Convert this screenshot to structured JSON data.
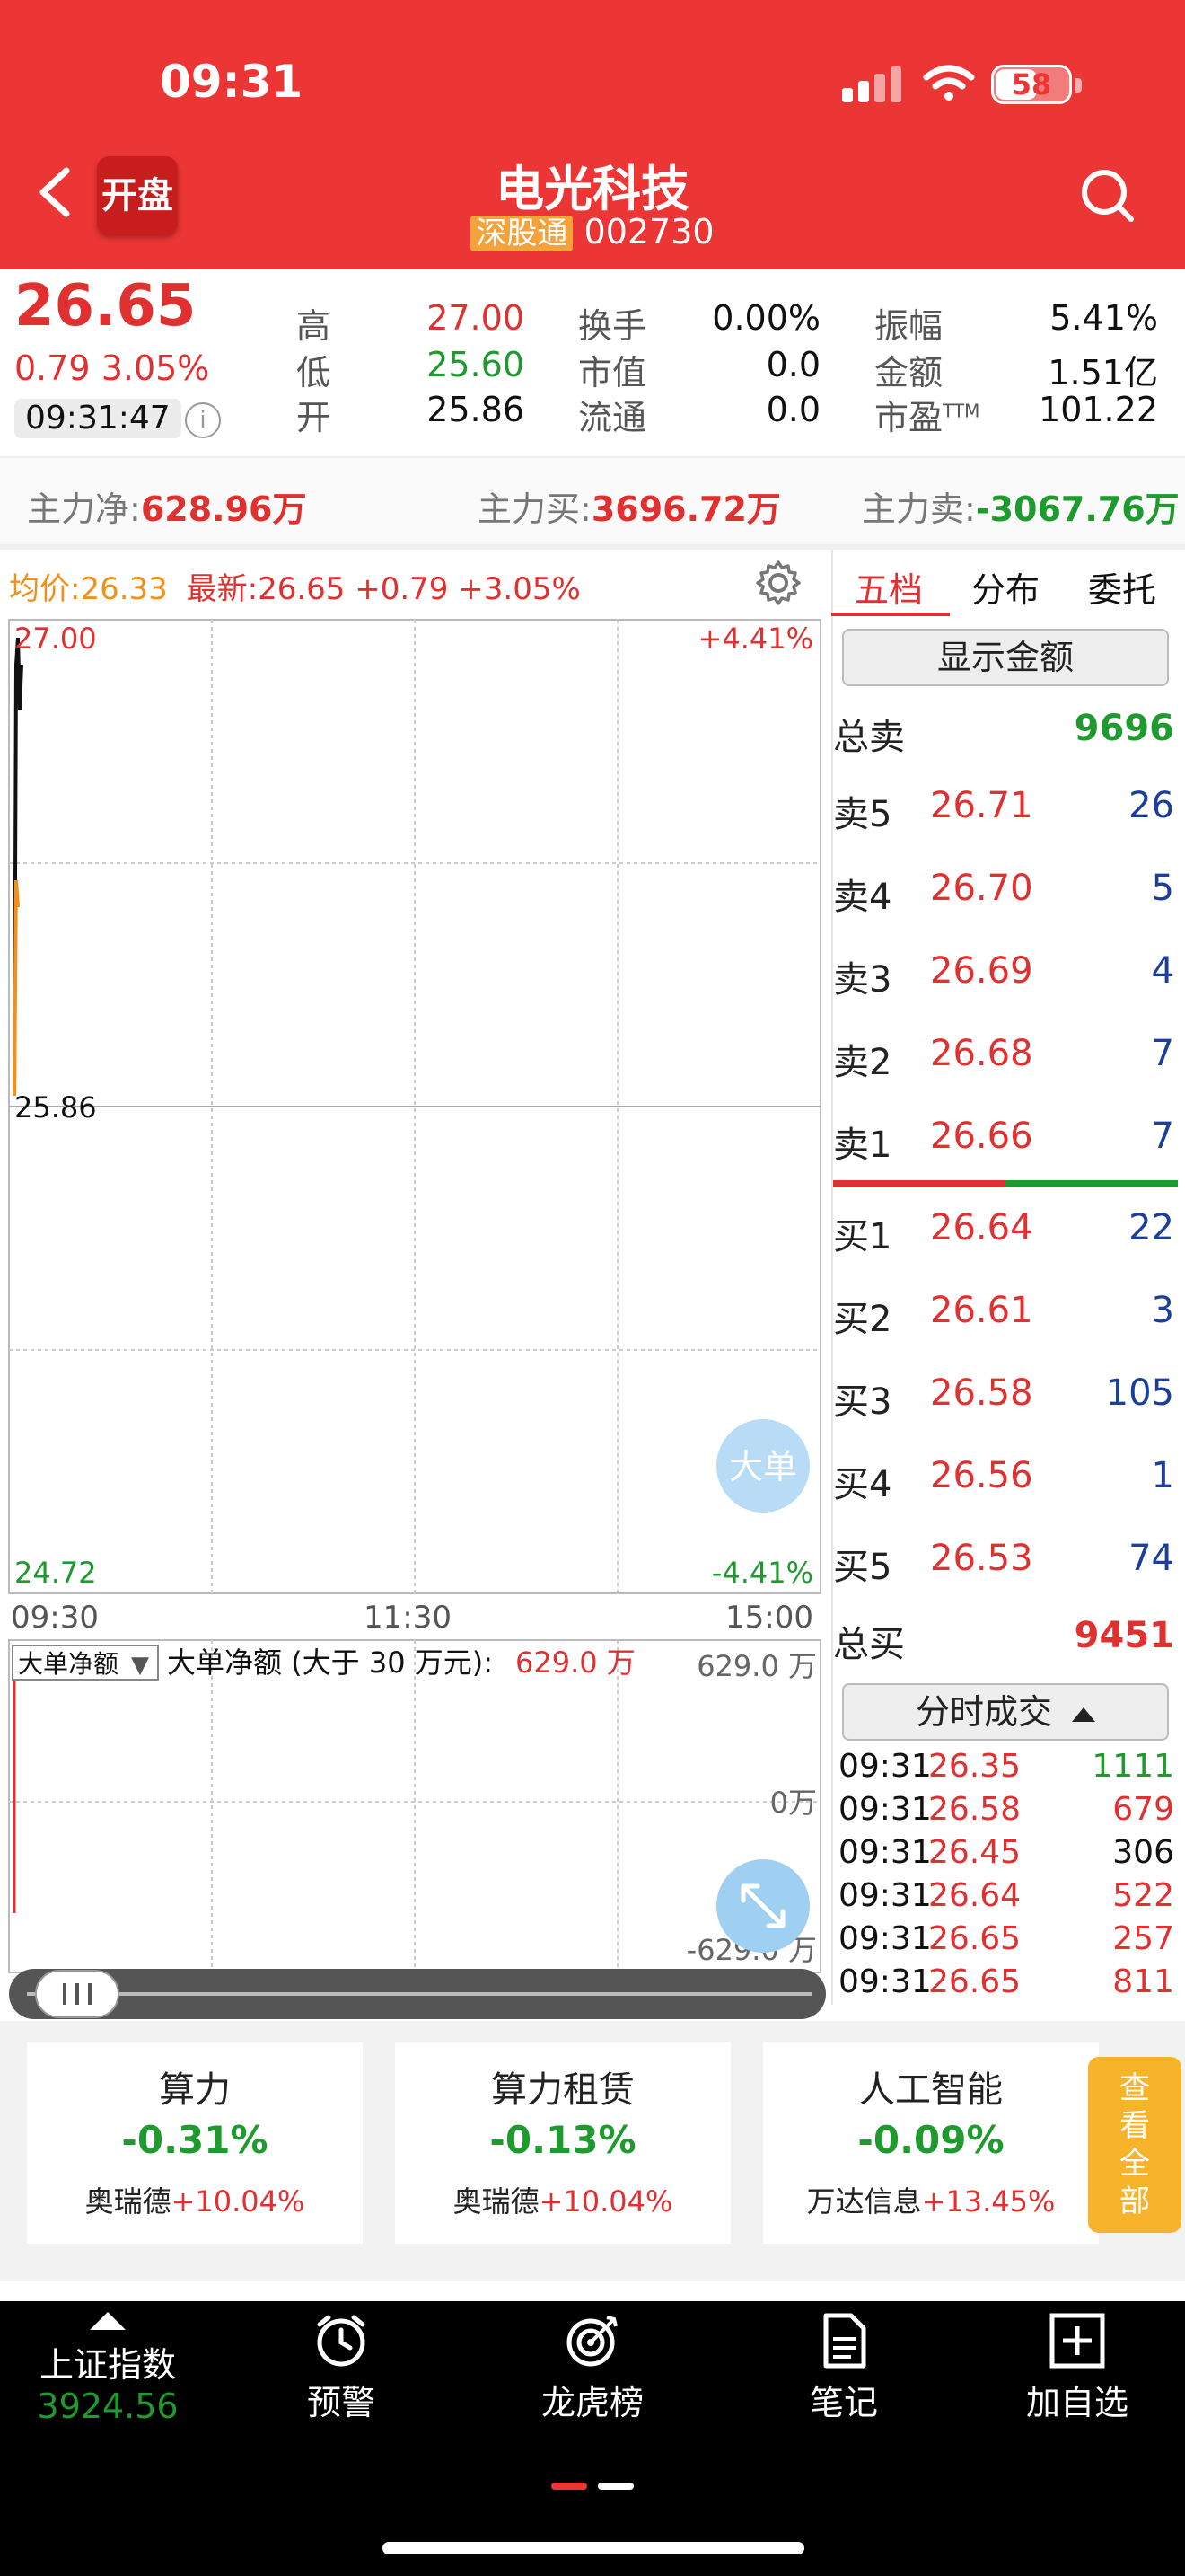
{
  "status": {
    "time": "09:31",
    "battery": "58"
  },
  "header": {
    "badge": "开盘",
    "name": "电光科技",
    "exchange_tag": "深股通",
    "code": "002730"
  },
  "quote": {
    "price": "26.65",
    "change": "0.79 3.05%",
    "time": "09:31:47",
    "fields": [
      {
        "label": "高",
        "value": "27.00",
        "color": "#e03030"
      },
      {
        "label": "低",
        "value": "25.60",
        "color": "#1f9a2e"
      },
      {
        "label": "开",
        "value": "25.86",
        "color": "#111111"
      },
      {
        "label": "换手",
        "value": "0.00%",
        "color": "#111111"
      },
      {
        "label": "市值",
        "value": "0.0",
        "color": "#111111"
      },
      {
        "label": "流通",
        "value": "0.0",
        "color": "#111111"
      },
      {
        "label": "振幅",
        "value": "5.41%",
        "color": "#111111"
      },
      {
        "label": "金额",
        "value": "1.51亿",
        "color": "#111111"
      },
      {
        "label": "市盈",
        "label_sup": "TTM",
        "value": "101.22",
        "color": "#111111"
      }
    ]
  },
  "flow": {
    "net_label": "主力净:",
    "net_value": "628.96万",
    "buy_label": "主力买:",
    "buy_value": "3696.72万",
    "sell_label": "主力卖:",
    "sell_value": "-3067.76万"
  },
  "chart_legend": {
    "avg_label": "均价:",
    "avg_value": "26.33",
    "latest_label": "最新:",
    "latest_value": "26.65",
    "latest_change": "+0.79",
    "latest_pct": "+3.05%"
  },
  "chart_data": [
    {
      "type": "line",
      "ylim": [
        24.72,
        27.0
      ],
      "y_ticks_left": [
        "27.00",
        "25.86",
        "24.72"
      ],
      "y_ticks_right": [
        "+4.41%",
        "-4.41%"
      ],
      "x_ticks": [
        "09:30",
        "11:30",
        "15:00"
      ],
      "series": [],
      "grid": true,
      "big_order_button": "大单"
    },
    {
      "type": "bar",
      "selector": "大单净额",
      "title_label": "大单净额 (大于 30 万元):",
      "title_value": "629.0 万",
      "y_ticks": [
        "629.0 万",
        "0万",
        "-629.0 万"
      ],
      "ylim": [
        -629.0,
        629.0
      ],
      "grid": true
    }
  ],
  "panel": {
    "tabs": [
      "五档",
      "分布",
      "委托"
    ],
    "show_amount": "显示金额",
    "total_sell_label": "总卖",
    "total_sell": "9696",
    "asks": [
      {
        "label": "卖5",
        "price": "26.71",
        "vol": "26"
      },
      {
        "label": "卖4",
        "price": "26.70",
        "vol": "5"
      },
      {
        "label": "卖3",
        "price": "26.69",
        "vol": "4"
      },
      {
        "label": "卖2",
        "price": "26.68",
        "vol": "7"
      },
      {
        "label": "卖1",
        "price": "26.66",
        "vol": "7"
      }
    ],
    "bids": [
      {
        "label": "买1",
        "price": "26.64",
        "vol": "22"
      },
      {
        "label": "买2",
        "price": "26.61",
        "vol": "3"
      },
      {
        "label": "买3",
        "price": "26.58",
        "vol": "105"
      },
      {
        "label": "买4",
        "price": "26.56",
        "vol": "1"
      },
      {
        "label": "买5",
        "price": "26.53",
        "vol": "74"
      }
    ],
    "total_buy_label": "总买",
    "total_buy": "9451",
    "ticks_button": "分时成交",
    "ticks": [
      {
        "time": "09:31",
        "price": "26.35",
        "vol": "1111",
        "color": "#1f9a2e"
      },
      {
        "time": "09:31",
        "price": "26.58",
        "vol": "679",
        "color": "#e03030"
      },
      {
        "time": "09:31",
        "price": "26.45",
        "vol": "306",
        "color": "#111111"
      },
      {
        "time": "09:31",
        "price": "26.64",
        "vol": "522",
        "color": "#e03030"
      },
      {
        "time": "09:31",
        "price": "26.65",
        "vol": "257",
        "color": "#e03030"
      },
      {
        "time": "09:31",
        "price": "26.65",
        "vol": "811",
        "color": "#e03030"
      }
    ]
  },
  "concepts": [
    {
      "name": "算力",
      "change": "-0.31%",
      "leader": "奥瑞德",
      "leader_change": "+10.04%"
    },
    {
      "name": "算力租赁",
      "change": "-0.13%",
      "leader": "奥瑞德",
      "leader_change": "+10.04%"
    },
    {
      "name": "人工智能",
      "change": "-0.09%",
      "leader": "万达信息",
      "leader_change": "+13.45%"
    }
  ],
  "see_all": "查看全部",
  "bottom": {
    "index_name": "上证指数",
    "index_value": "3924.56",
    "items": [
      {
        "label": "预警",
        "icon": "alarm-clock-icon"
      },
      {
        "label": "龙虎榜",
        "icon": "target-icon"
      },
      {
        "label": "笔记",
        "icon": "note-icon"
      },
      {
        "label": "加自选",
        "icon": "add-square-icon"
      }
    ]
  },
  "colors": {
    "header": "#ec3535",
    "up": "#e03030",
    "down": "#1f9a2e",
    "bid_vol": "#1c3f9c"
  }
}
